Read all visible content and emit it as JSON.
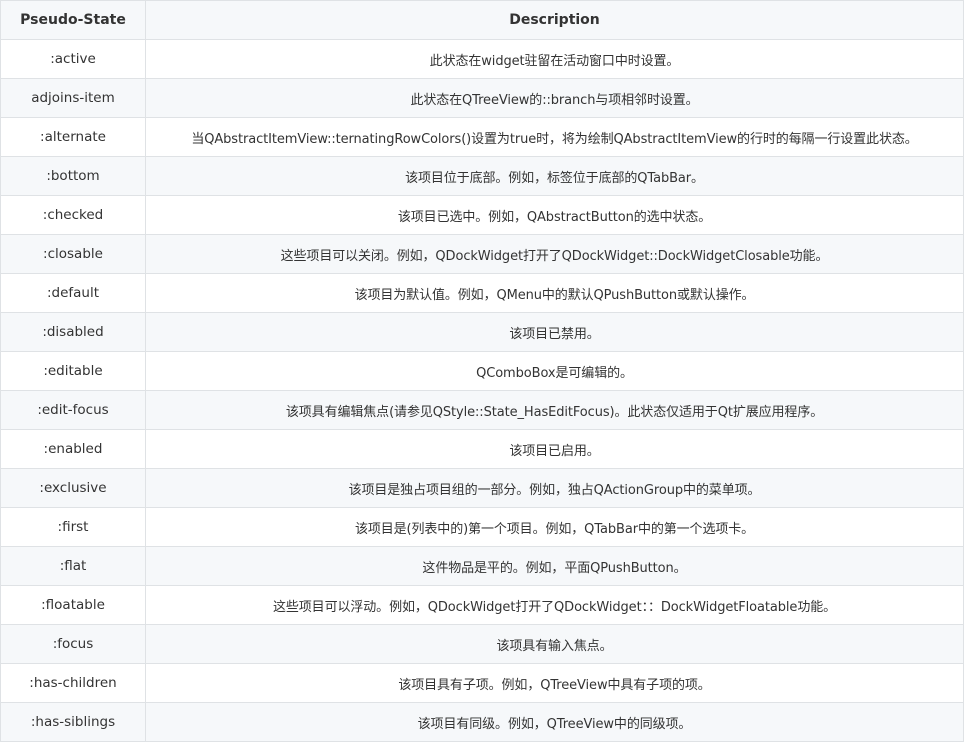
{
  "table": {
    "headers": [
      "Pseudo-State",
      "Description"
    ],
    "rows": [
      {
        "state": ":active",
        "desc": "此状态在widget驻留在活动窗口中时设置。"
      },
      {
        "state": "adjoins-item",
        "desc": "此状态在QTreeView的::branch与项相邻时设置。"
      },
      {
        "state": ":alternate",
        "desc": "当QAbstractItemView::ternatingRowColors()设置为true时，将为绘制QAbstractItemView的行时的每隔一行设置此状态。"
      },
      {
        "state": ":bottom",
        "desc": "该项目位于底部。例如，标签位于底部的QTabBar。"
      },
      {
        "state": ":checked",
        "desc": "该项目已选中。例如，QAbstractButton的选中状态。"
      },
      {
        "state": ":closable",
        "desc": "这些项目可以关闭。例如，QDockWidget打开了QDockWidget::DockWidgetClosable功能。"
      },
      {
        "state": ":default",
        "desc": "该项目为默认值。例如，QMenu中的默认QPushButton或默认操作。"
      },
      {
        "state": ":disabled",
        "desc": "该项目已禁用。"
      },
      {
        "state": ":editable",
        "desc": "QComboBox是可编辑的。"
      },
      {
        "state": ":edit-focus",
        "desc": "该项具有编辑焦点(请参见QStyle::State_HasEditFocus)。此状态仅适用于Qt扩展应用程序。"
      },
      {
        "state": ":enabled",
        "desc": "该项目已启用。"
      },
      {
        "state": ":exclusive",
        "desc": "该项目是独占项目组的一部分。例如，独占QActionGroup中的菜单项。"
      },
      {
        "state": ":first",
        "desc": "该项目是(列表中的)第一个项目。例如，QTabBar中的第一个选项卡。"
      },
      {
        "state": ":flat",
        "desc": "这件物品是平的。例如，平面QPushButton。"
      },
      {
        "state": ":floatable",
        "desc": "这些项目可以浮动。例如，QDockWidget打开了QDockWidget：：DockWidgetFloatable功能。"
      },
      {
        "state": ":focus",
        "desc": "该项具有输入焦点。"
      },
      {
        "state": ":has-children",
        "desc": "该项目具有子项。例如，QTreeView中具有子项的项。"
      },
      {
        "state": ":has-siblings",
        "desc": "该项目有同级。例如，QTreeView中的同级项。"
      }
    ]
  }
}
